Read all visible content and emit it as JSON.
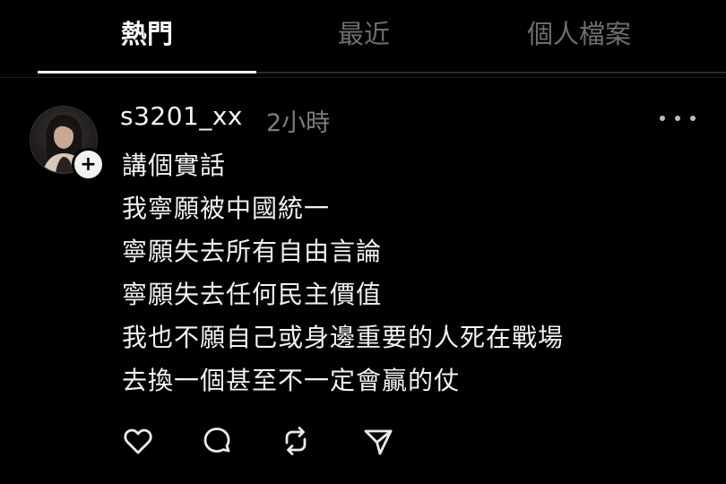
{
  "tabs": [
    {
      "label": "熱門",
      "active": true
    },
    {
      "label": "最近",
      "active": false
    },
    {
      "label": "個人檔案",
      "active": false
    }
  ],
  "post": {
    "username": "s3201_xx",
    "time": "2小時",
    "follow_symbol": "+",
    "lines": [
      "講個實話",
      "我寧願被中國統一",
      "寧願失去所有自由言論",
      "寧願失去任何民主價值",
      "我也不願自己或身邊重要的人死在戰場",
      "去換一個甚至不一定會贏的仗"
    ],
    "actions": [
      "heart-icon",
      "comment-icon",
      "repost-icon",
      "share-icon"
    ]
  },
  "colors": {
    "background": "#000000",
    "text": "#f2f2f2",
    "muted": "#7d7d7d",
    "inactive_tab": "#6e6e6e"
  }
}
